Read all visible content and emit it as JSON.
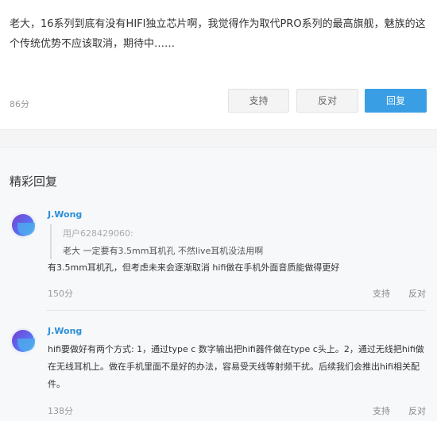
{
  "post": {
    "text": "老大，16系列到底有没有HIFI独立芯片啊，我觉得作为取代PRO系列的最高旗舰，魅族的这个传统优势不应该取消，期待中……",
    "score": "86分",
    "support_label": "支持",
    "oppose_label": "反对",
    "reply_label": "回复"
  },
  "section": {
    "title": "精彩回复"
  },
  "replies": [
    {
      "username": "J.Wong",
      "quote_user": "用户628429060:",
      "quote_text": "老大 一定要有3.5mm耳机孔 不然live耳机没法用啊",
      "text": "有3.5mm耳机孔，但考虑未来会逐渐取消 hifi做在手机外面音质能做得更好",
      "score": "150分",
      "support_label": "支持",
      "oppose_label": "反对"
    },
    {
      "username": "J.Wong",
      "text": "hifi要做好有两个方式: 1，通过type c 数字输出把hifi器件做在type c头上。2，通过无线把hifi做在无线耳机上。做在手机里面不是好的办法，容易受天线等射频干扰。后续我们会推出hifi相关配件。",
      "score": "138分",
      "support_label": "支持",
      "oppose_label": "反对"
    }
  ]
}
